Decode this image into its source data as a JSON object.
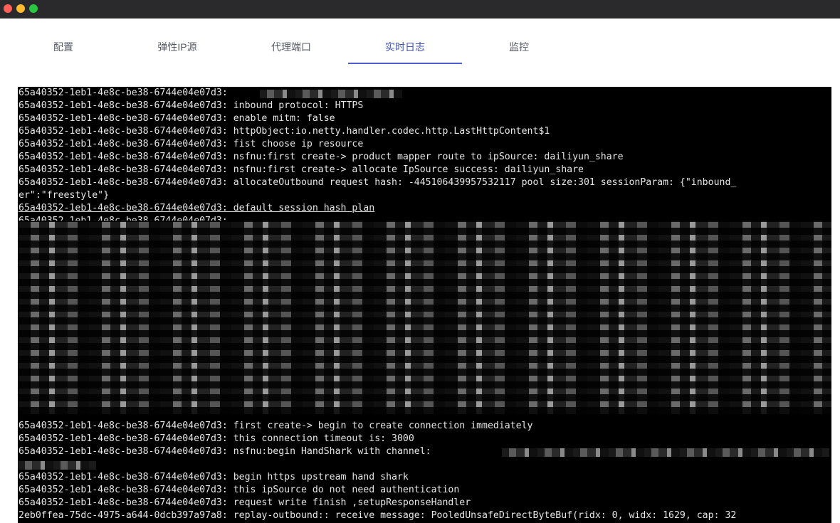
{
  "tabs": [
    {
      "label": "配置",
      "active": false
    },
    {
      "label": "弹性IP源",
      "active": false
    },
    {
      "label": "代理端口",
      "active": false
    },
    {
      "label": "实时日志",
      "active": true
    },
    {
      "label": "监控",
      "active": false
    }
  ],
  "colors": {
    "titlebar": "#2a2a2c",
    "tab_active": "#3f51b5",
    "tab_inactive": "#555a66",
    "console_bg": "#000000",
    "console_text": "#e6e6e6"
  },
  "log": {
    "lines": [
      "65a40352-1eb1-4e8c-be38-6744e04e07d3: ",
      "65a40352-1eb1-4e8c-be38-6744e04e07d3: inbound protocol: HTTPS",
      "65a40352-1eb1-4e8c-be38-6744e04e07d3: enable mitm: false",
      "65a40352-1eb1-4e8c-be38-6744e04e07d3: httpObject:io.netty.handler.codec.http.LastHttpContent$1",
      "65a40352-1eb1-4e8c-be38-6744e04e07d3: fist choose ip resource",
      "65a40352-1eb1-4e8c-be38-6744e04e07d3: nsfnu:first create-> product mapper route to ipSource: dailiyun_share",
      "65a40352-1eb1-4e8c-be38-6744e04e07d3: nsfnu:first create-> allocate IpSource success: dailiyun_share",
      "65a40352-1eb1-4e8c-be38-6744e04e07d3: allocateOutbound request hash: -4451064399575321​17 pool size:301 sessionParam: {\"inbound_",
      "er\":\"freestyle\"}",
      "65a40352-1eb1-4e8c-be38-6744e04e07d3: default session hash plan",
      "65a40352-1eb1-4e8c-be38-6744e04e07d3: ",
      "65a40352-1eb1-4e8c-be38-6744e04e07d3: first create-> begin to create connection immediately",
      "65a40352-1eb1-4e8c-be38-6744e04e07d3: this connection timeout is: 3000",
      "65a40352-1eb1-4e8c-be38-6744e04e07d3: nsfnu:begin HandShark with channel: ",
      "65a40352-1eb1-4e8c-be38-6744e04e07d3: begin https upstream hand shark",
      "65a40352-1eb1-4e8c-be38-6744e04e07d3: this ipSource do not need authentication",
      "65a40352-1eb1-4e8c-be38-6744e04e07d3: request write finish ,setupResponseHandler",
      "2eb0ffea-75dc-4975-a644-0dcb397a97a8: replay-outbound:: receive message: PooledUnsafeDirectByteBuf(ridx: 0, widx: 1629, cap: 32"
    ]
  }
}
